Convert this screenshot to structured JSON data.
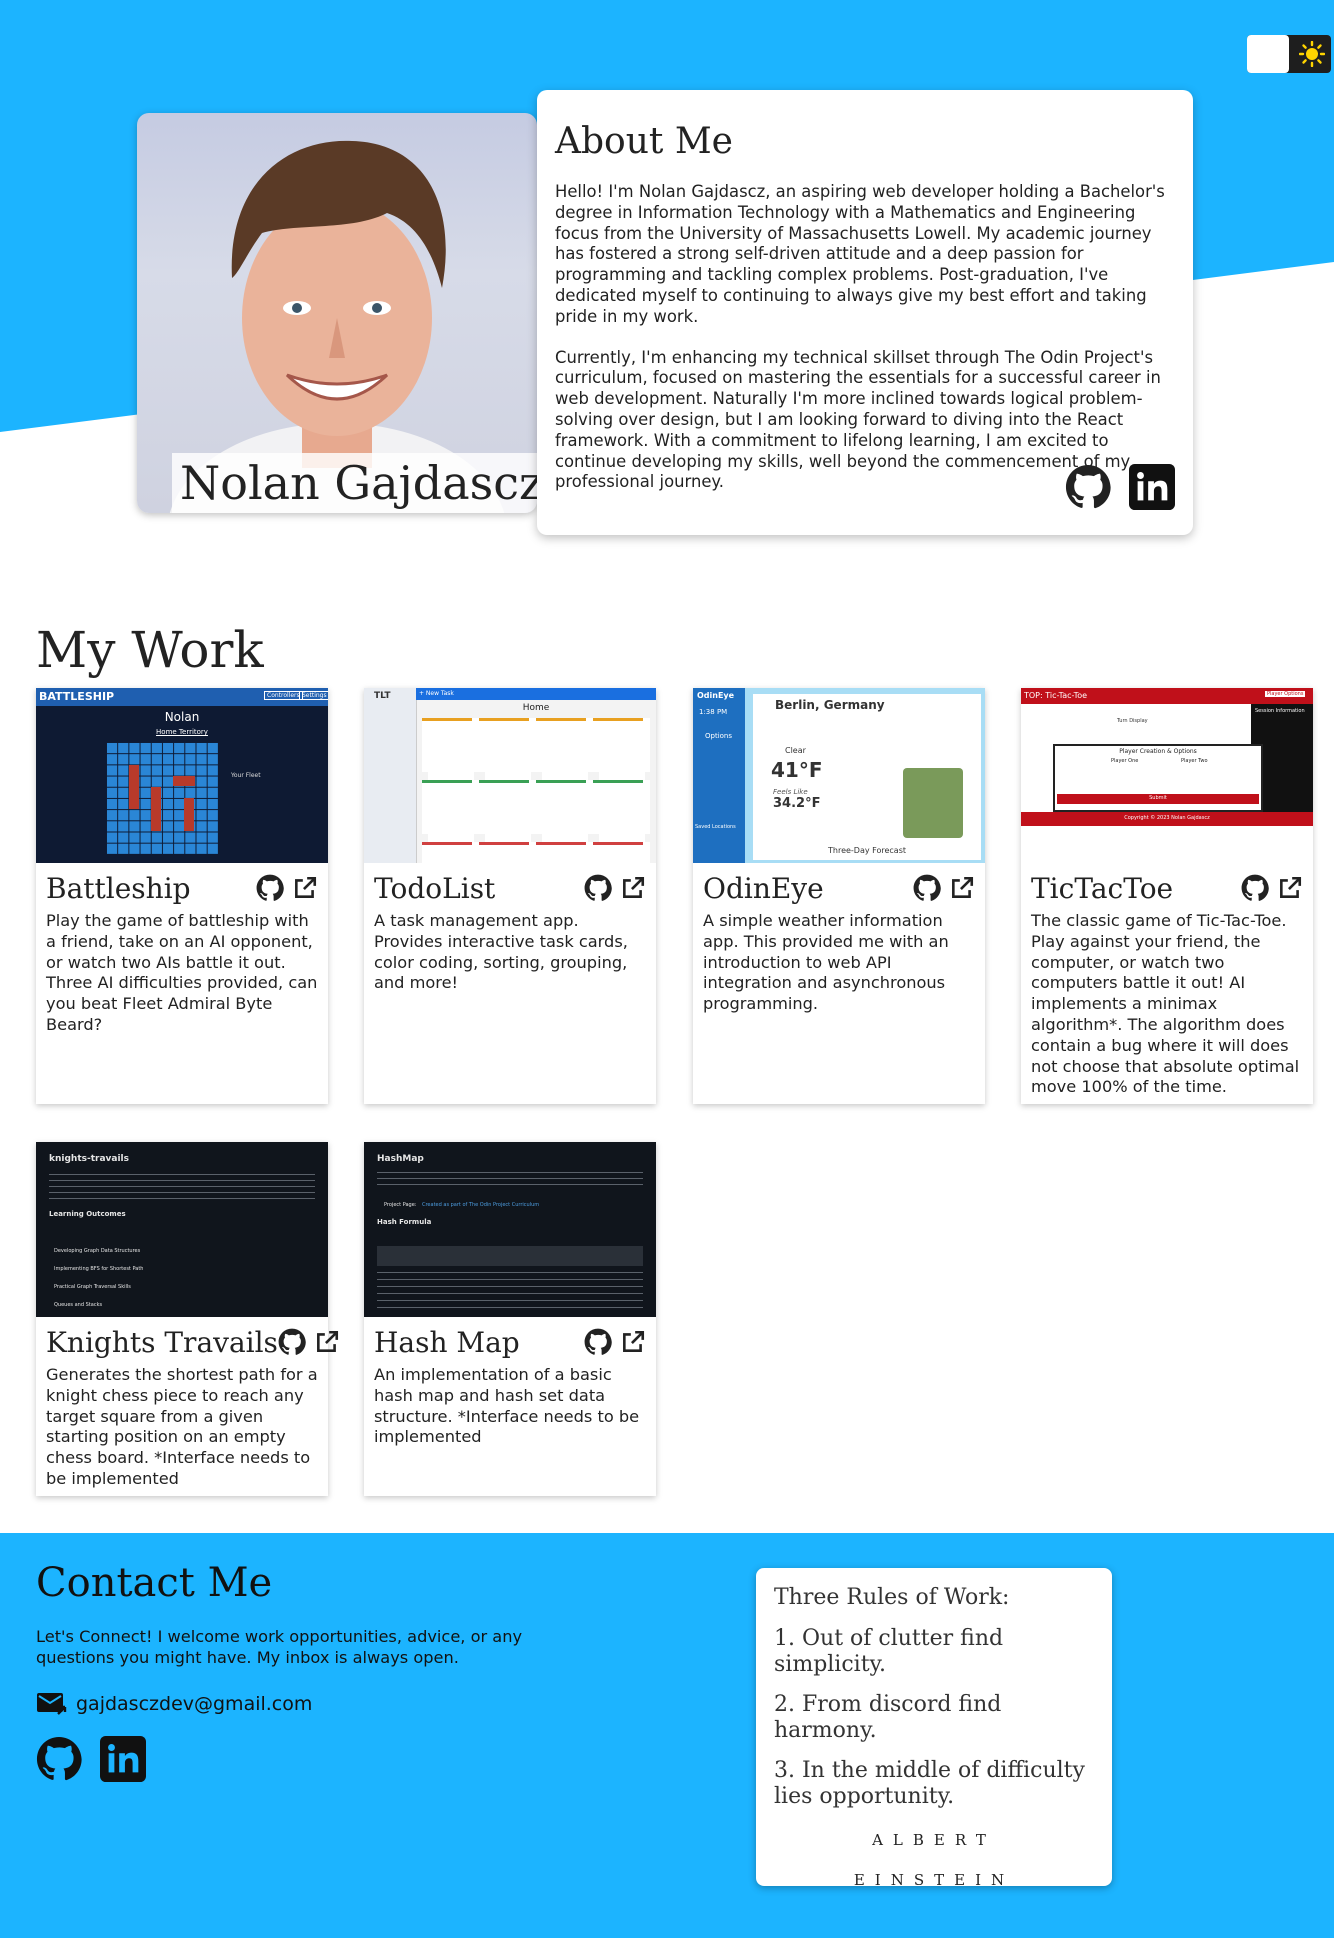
{
  "colors": {
    "accent": "#1cb4ff",
    "text": "#222222",
    "card": "#ffffff"
  },
  "theme_toggle": {
    "icon": "sun-icon"
  },
  "profile": {
    "name": "Nolan Gajdascz"
  },
  "about": {
    "title": "About Me",
    "paragraphs": [
      "Hello! I'm Nolan Gajdascz, an aspiring web developer holding a Bachelor's degree in Information Technology with a Mathematics and Engineering focus from the University of Massachusetts Lowell. My academic journey has fostered a strong self-driven attitude and a deep passion for programming and tackling complex problems. Post-graduation, I've dedicated myself to continuing to always give my best effort and taking pride in my work.",
      "Currently, I'm enhancing my technical skillset through The Odin Project's curriculum, focused on mastering the essentials for a successful career in web development. Naturally I'm more inclined towards logical problem-solving over design, but I am looking forward to diving into the React framework. With a commitment to lifelong learning, I am excited to continue developing my skills, well beyond the commencement of my professional journey."
    ]
  },
  "work": {
    "title": "My Work",
    "projects": [
      {
        "name": "Battleship",
        "description": "Play the game of battleship with a friend, take on an AI opponent, or watch two AIs battle it out. Three AI difficulties provided, can you beat Fleet Admiral Byte Beard?",
        "thumb": {
          "title": "BATTLESHIP",
          "player": "Nolan",
          "territory": "Home Territory",
          "panel": "Your Fleet",
          "btn1": "Controllers",
          "btn2": "Settings"
        }
      },
      {
        "name": "TodoList",
        "description": "A task management app. Provides interactive task cards, color coding, sorting, grouping, and more!",
        "thumb": {
          "logo": "TLT",
          "heading": "Home",
          "new_task": "+ New Task"
        }
      },
      {
        "name": "OdinEye",
        "description": "A simple weather information app. This provided me with an introduction to web API integration and asynchronous programming.",
        "thumb": {
          "app": "OdinEye",
          "time": "1:38 PM",
          "city": "Berlin, Germany",
          "condition": "Clear",
          "temp": "41°F",
          "feels_label": "Feels Like",
          "feels": "34.2°F",
          "options": "Options",
          "saved": "Saved Locations",
          "forecast": "Three-Day Forecast"
        }
      },
      {
        "name": "TicTacToe",
        "description": "The classic game of Tic-Tac-Toe. Play against your friend, the computer, or watch two computers battle it out! AI implements a minimax algorithm*. The algorithm does contain a bug where it will does not choose that absolute optimal move 100% of the time.",
        "thumb": {
          "title": "TOP: Tic-Tac-Toe",
          "options": "Player Options",
          "turn": "Turn Display",
          "session": "Session Information",
          "dialog": "Player Creation & Options",
          "p1": "Player One",
          "p2": "Player Two",
          "submit": "Submit",
          "footer": "Copyright © 2023 Nolan Gajdascz"
        }
      },
      {
        "name": "Knights Travails",
        "description": "Generates the shortest path for a knight chess piece to reach any target square from a given starting position on an empty chess board. *Interface needs to be implemented",
        "thumb": {
          "heading": "knights-travails",
          "sub": "Learning Outcomes",
          "bullets": [
            "Developing Graph Data Structures",
            "Implementing BFS for Shortest Path",
            "Practical Graph Traversal Skills",
            "Queues and Stacks"
          ]
        }
      },
      {
        "name": "Hash Map",
        "description": "An implementation of a basic hash map and hash set data structure. *Interface needs to be implemented",
        "thumb": {
          "heading": "HashMap",
          "sub": "Hash Formula",
          "link_label": "Project Page:",
          "link": "Created as part of The Odin Project Curriculum"
        }
      }
    ]
  },
  "contact": {
    "title": "Contact Me",
    "text": "Let's Connect! I welcome work opportunities, advice, or any questions you might have. My inbox is always open.",
    "email": "gajdasczdev@gmail.com"
  },
  "quote": {
    "heading": "Three Rules of Work:",
    "rules": [
      "1. Out of clutter find simplicity.",
      "2. From discord find harmony.",
      "3. In the middle of difficulty lies opportunity."
    ],
    "author_first": "ALBERT",
    "author_last": "EINSTEIN"
  }
}
